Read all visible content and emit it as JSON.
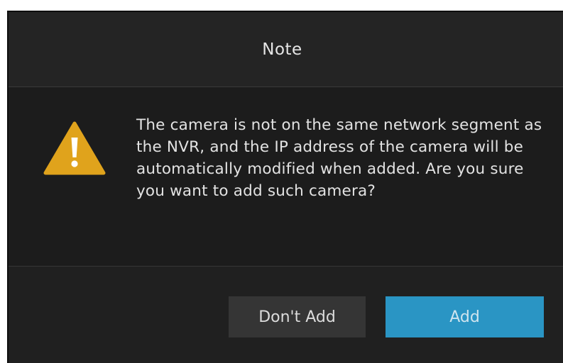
{
  "dialog": {
    "title": "Note",
    "message": "The camera is not on the same network segment as the NVR, and the IP address of the camera will be automatically modified when added. Are you sure you want to add such camera?",
    "icon": "warning-icon",
    "buttons": {
      "cancel_label": "Don't Add",
      "confirm_label": "Add"
    }
  },
  "colors": {
    "dialog_background": "#202020",
    "warning_icon": "#e0a31c",
    "confirm_button": "#2a95c4",
    "cancel_button": "#353535"
  }
}
